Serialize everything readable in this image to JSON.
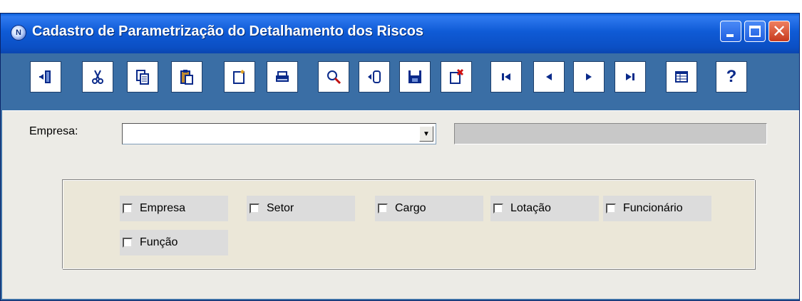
{
  "window": {
    "title": "Cadastro de Parametrização do Detalhamento dos Riscos",
    "icon": "app-logo-icon",
    "icon_letter": "N"
  },
  "toolbar": {
    "buttons": [
      {
        "name": "exit-button",
        "icon": "exit-door-icon"
      },
      {
        "name": "cut-button",
        "icon": "scissors-icon"
      },
      {
        "name": "copy-button",
        "icon": "copy-icon"
      },
      {
        "name": "paste-button",
        "icon": "paste-icon"
      },
      {
        "name": "new-button",
        "icon": "new-document-icon"
      },
      {
        "name": "print-button",
        "icon": "printer-icon"
      },
      {
        "name": "search-button",
        "icon": "magnifier-icon"
      },
      {
        "name": "import-button",
        "icon": "database-import-icon"
      },
      {
        "name": "save-button",
        "icon": "floppy-icon"
      },
      {
        "name": "delete-button",
        "icon": "delete-document-icon"
      },
      {
        "name": "first-record-button",
        "icon": "first-icon"
      },
      {
        "name": "previous-record-button",
        "icon": "previous-icon"
      },
      {
        "name": "next-record-button",
        "icon": "next-icon"
      },
      {
        "name": "last-record-button",
        "icon": "last-icon"
      },
      {
        "name": "grid-view-button",
        "icon": "table-icon"
      },
      {
        "name": "help-button",
        "icon": "help-icon",
        "glyph": "?"
      }
    ]
  },
  "form": {
    "empresa_label": "Empresa:",
    "empresa_value": "",
    "empresa_name": "",
    "combo_arrow": "▼"
  },
  "options": {
    "checkboxes": [
      {
        "label": "Empresa",
        "checked": false
      },
      {
        "label": "Setor",
        "checked": false
      },
      {
        "label": "Cargo",
        "checked": false
      },
      {
        "label": "Lotação",
        "checked": false
      },
      {
        "label": "Funcionário",
        "checked": false
      },
      {
        "label": "Função",
        "checked": false
      }
    ]
  },
  "colors": {
    "titlebar": "#0b4fc4",
    "toolbar": "#3a6ea5",
    "client": "#ecebe6",
    "group": "#ebe7d8",
    "icon_blue": "#0a2a8a",
    "icon_red": "#d01010"
  }
}
